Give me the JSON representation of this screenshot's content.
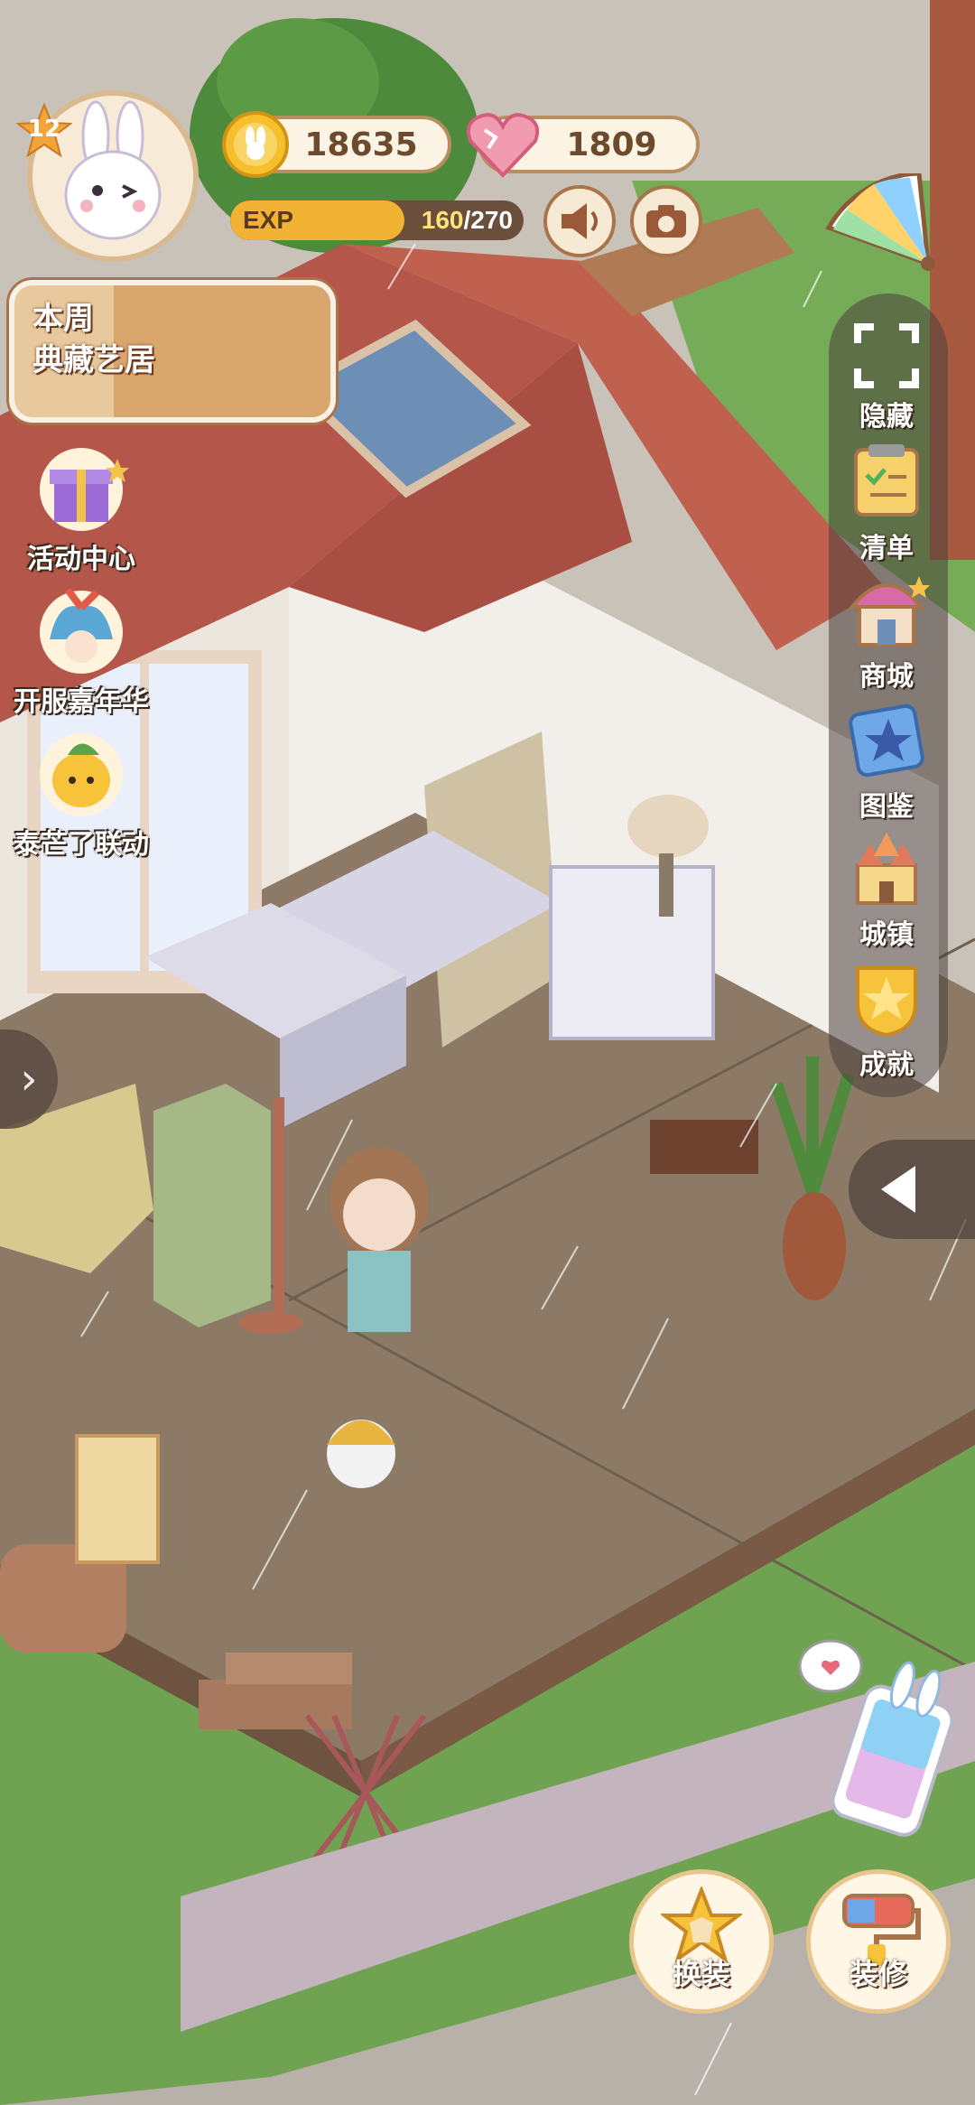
{
  "player": {
    "level": "12",
    "coins": "18635",
    "hearts": "1809",
    "exp_label": "EXP",
    "exp_current": "160",
    "exp_total": "/270",
    "exp_fraction": 0.593
  },
  "weekly_banner": {
    "line1": "本周",
    "line2": "典藏艺居"
  },
  "left_menu": [
    {
      "label": "活动中心"
    },
    {
      "label": "开服嘉年华"
    },
    {
      "label": "泰芒了联动"
    }
  ],
  "right_menu": [
    {
      "label": "隐藏"
    },
    {
      "label": "清单"
    },
    {
      "label": "商城"
    },
    {
      "label": "图鉴"
    },
    {
      "label": "城镇"
    },
    {
      "label": "成就"
    }
  ],
  "bottom_buttons": {
    "dress": "换装",
    "decorate": "装修"
  },
  "icons": [
    "speaker-icon",
    "camera-icon",
    "palette-fan-icon",
    "coin-icon",
    "heart-gem-icon",
    "expand-frame-icon",
    "chevron-right-icon",
    "chevron-left-icon",
    "phone-icon"
  ],
  "colors": {
    "roof": "#b4574a",
    "floor": "#8c7a66",
    "grass": "#6fa352",
    "exp_fill": "#f2b233"
  }
}
